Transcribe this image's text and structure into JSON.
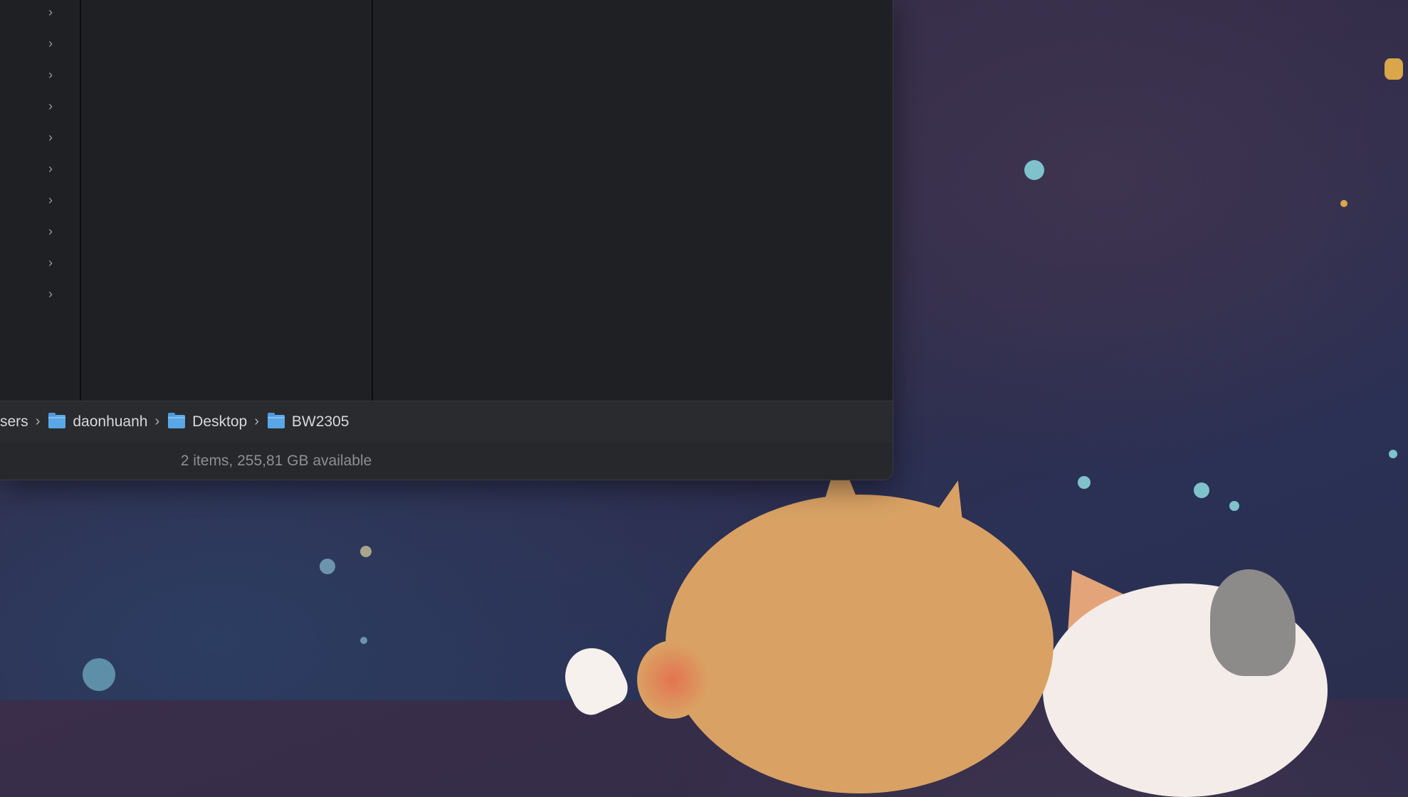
{
  "finder": {
    "path": [
      {
        "label": "sers",
        "icon": "none"
      },
      {
        "label": "daonhuanh",
        "icon": "home-folder-icon"
      },
      {
        "label": "Desktop",
        "icon": "desktop-folder-icon"
      },
      {
        "label": "BW2305",
        "icon": "folder-icon"
      }
    ],
    "status": "2 items, 255,81 GB available",
    "sidebar_chevron_icon": "chevron-right-icon"
  },
  "colors": {
    "window_bg": "#1f2023",
    "folder_blue": "#5aa7e8",
    "text": "#d8d8dc",
    "status_text": "#8f8f93"
  }
}
